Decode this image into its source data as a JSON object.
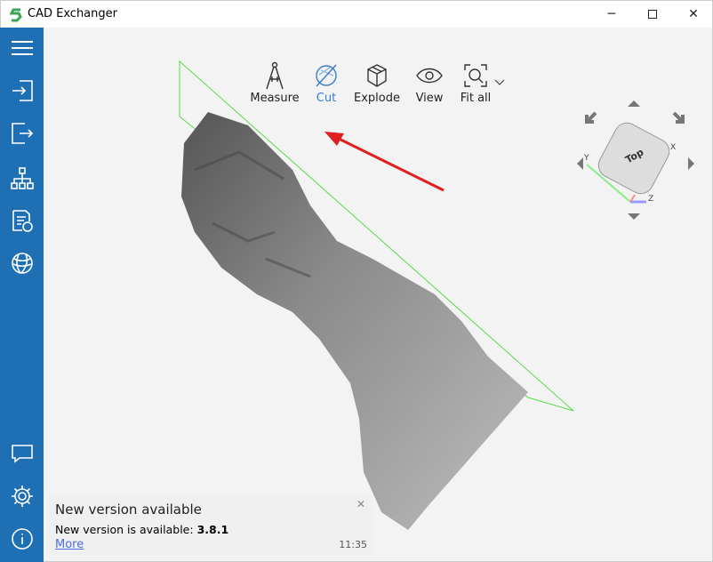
{
  "window": {
    "title": "CAD Exchanger",
    "minimize_icon": "minimize-icon",
    "maximize_icon": "maximize-icon",
    "close_icon": "close-icon"
  },
  "sidebar": {
    "items": [
      {
        "icon": "menu-icon"
      },
      {
        "icon": "import-icon"
      },
      {
        "icon": "export-icon"
      },
      {
        "icon": "structure-icon"
      },
      {
        "icon": "properties-icon"
      },
      {
        "icon": "web-icon"
      },
      {
        "icon": "feedback-icon"
      },
      {
        "icon": "settings-icon"
      },
      {
        "icon": "info-icon"
      }
    ],
    "color": "#1e6fb3"
  },
  "toolbar": {
    "items": [
      {
        "label": "Measure",
        "icon": "compass-icon"
      },
      {
        "label": "Cut",
        "icon": "cut-icon",
        "active": true
      },
      {
        "label": "Explode",
        "icon": "cube-icon"
      },
      {
        "label": "View",
        "icon": "eye-icon"
      },
      {
        "label": "Fit all",
        "icon": "fit-all-icon"
      }
    ],
    "active_color": "#3a7dc9"
  },
  "view_cube": {
    "face_label": "Top",
    "axes": [
      "X",
      "Y",
      "Z"
    ]
  },
  "notification": {
    "title": "New version available",
    "body_prefix": "New version is available: ",
    "version": "3.8.1",
    "link": "More",
    "time": "11:35"
  }
}
